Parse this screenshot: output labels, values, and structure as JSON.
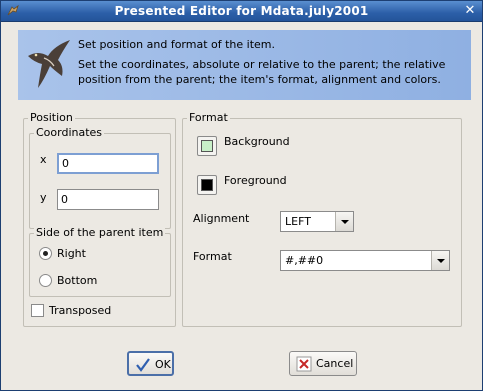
{
  "window": {
    "title": "Presented Editor for Mdata.july2001",
    "close_label": "✕"
  },
  "banner": {
    "title": "Set position and format of the item.",
    "description": "Set the coordinates, absolute or relative to the parent; the relative position from the parent; the item's format, alignment and colors."
  },
  "position": {
    "label": "Position",
    "coordinates": {
      "label": "Coordinates",
      "x_label": "x",
      "x_value": "0",
      "y_label": "y",
      "y_value": "0"
    },
    "side": {
      "label": "Side of the parent item",
      "options": [
        "Right",
        "Bottom"
      ],
      "selected": "Right"
    },
    "transposed_label": "Transposed",
    "transposed_checked": false
  },
  "format": {
    "label": "Format",
    "background_label": "Background",
    "background_color": "#c8f0c8",
    "foreground_label": "Foreground",
    "foreground_color": "#000000",
    "alignment_label": "Alignment",
    "alignment_value": "LEFT",
    "format_label": "Format",
    "format_value": "#,##0"
  },
  "buttons": {
    "ok_label": "OK",
    "cancel_label": "Cancel"
  }
}
